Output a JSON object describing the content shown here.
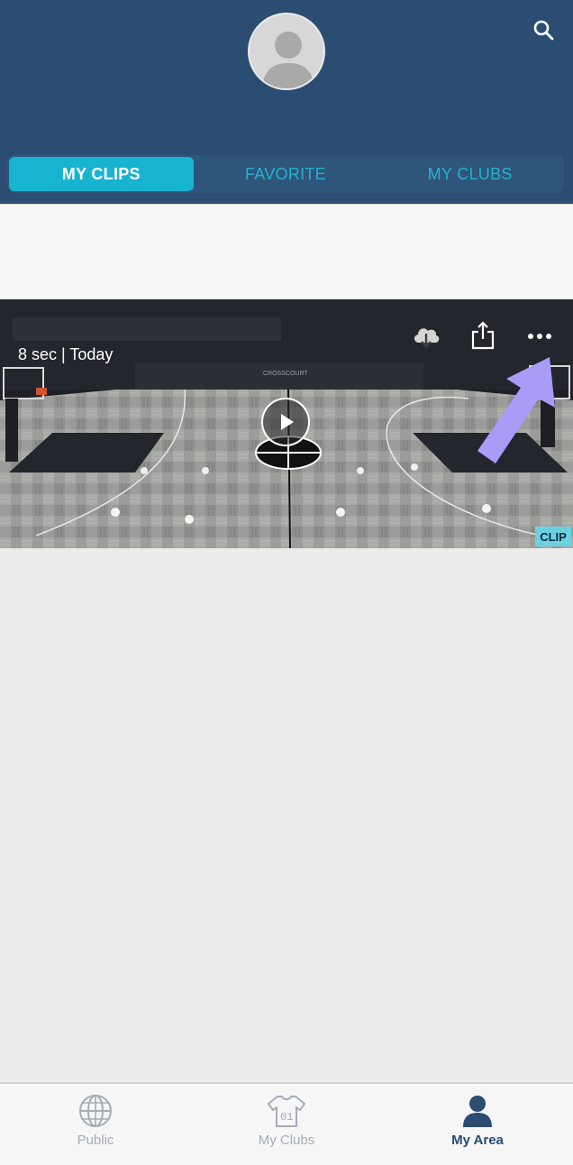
{
  "header": {
    "tabs": [
      {
        "label": "MY CLIPS",
        "active": true
      },
      {
        "label": "FAVORITE",
        "active": false
      },
      {
        "label": "MY CLUBS",
        "active": false
      }
    ]
  },
  "clip": {
    "meta": "8 sec | Today",
    "badge": "CLIP",
    "court_wall_text": "CROSSCOURT"
  },
  "bottom_nav": {
    "items": [
      {
        "label": "Public",
        "icon": "globe-icon",
        "active": false
      },
      {
        "label": "My Clubs",
        "icon": "jersey-icon",
        "jersey_number": "01",
        "active": false
      },
      {
        "label": "My Area",
        "icon": "person-icon",
        "active": true
      }
    ]
  },
  "colors": {
    "header_bg": "#2b4d72",
    "accent": "#16b4d0",
    "highlight_arrow": "#a99cf7",
    "nav_active": "#2b4d72",
    "nav_inactive": "#a6acb6"
  }
}
